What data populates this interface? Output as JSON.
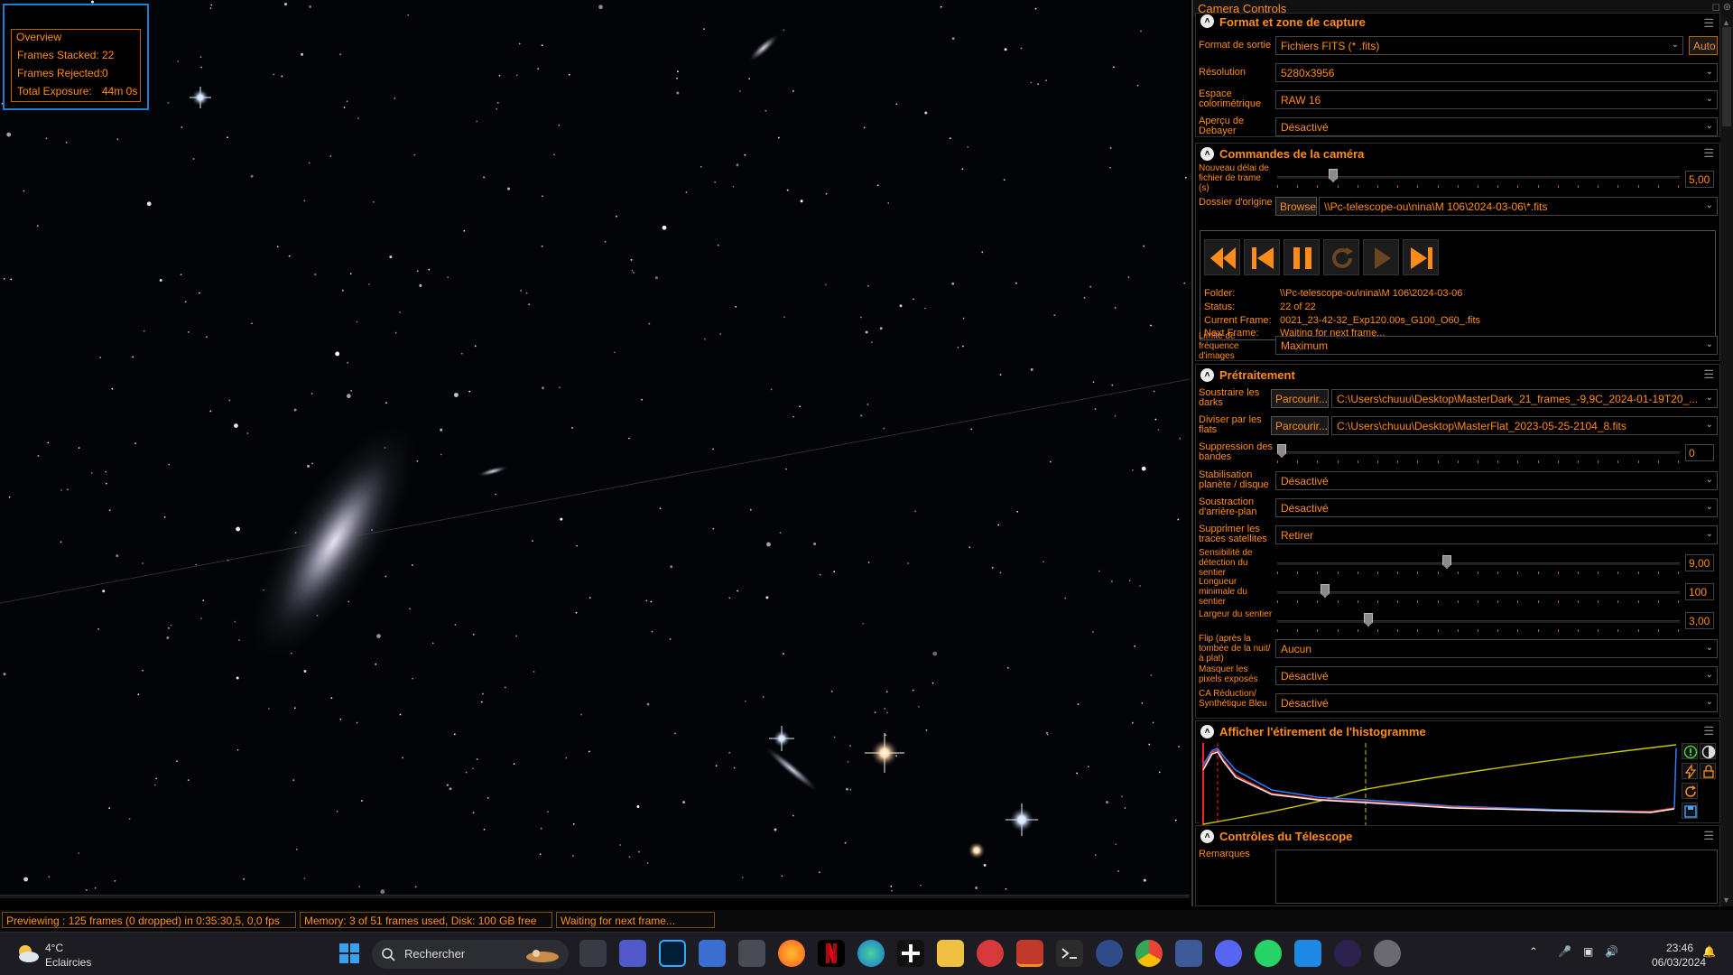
{
  "overview": {
    "title": "Overview",
    "stats": [
      {
        "label": "Frames Stacked:",
        "value": "22"
      },
      {
        "label": "Frames Rejected:",
        "value": "0"
      },
      {
        "label": "Total Exposure:",
        "value": "44m 0s"
      }
    ]
  },
  "statusbar": {
    "preview": "Previewing : 125 frames (0 dropped) in 0:35:30,5, 0,0 fps",
    "memory": "Memory: 3 of 51 frames used, Disk: 100 GB free",
    "status": "Waiting for next frame..."
  },
  "panel": {
    "title": "Camera Controls",
    "format": {
      "title": "Format et zone de capture",
      "output_label": "Format de sortie",
      "output_value": "Fichiers FITS (* .fits)",
      "auto_label": "Auto",
      "resolution_label": "Résolution",
      "resolution_value": "5280x3956",
      "colorspace_label": "Espace colorimétrique",
      "colorspace_value": "RAW 16",
      "debayer_label": "Aperçu de Debayer",
      "debayer_value": "Désactivé"
    },
    "camera": {
      "title": "Commandes de la caméra",
      "delay_label": "Nouveau délai de fichier de trame (s)",
      "delay_value": "5,00",
      "delay_level": 0.13,
      "folder_label": "Dossier d'origine",
      "browse_label": "Browse",
      "folder_value": "\\\\Pc-telescope-ou\\nina\\M 106\\2024-03-06\\*.fits",
      "info": {
        "folder_label": "Folder:",
        "folder_value": "\\\\Pc-telescope-ou\\nina\\M 106\\2024-03-06",
        "status_label": "Status:",
        "status_value": "22 of 22",
        "current_label": "Current Frame:",
        "current_value": "0021_23-42-32_Exp120.00s_G100_O60_.fits",
        "next_label": "Next Frame:",
        "next_value": "Waiting for next frame..."
      },
      "rate_label": "Limite de fréquence d'images",
      "rate_value": "Maximum"
    },
    "preprocess": {
      "title": "Prétraitement",
      "darks_label": "Soustraire les darks",
      "darks_button": "Parcourir...",
      "darks_value": "C:\\Users\\chuuu\\Desktop\\MasterDark_21_frames_-9,9C_2024-01-19T20_...",
      "flats_label": "Diviser par les flats",
      "flats_button": "Parcourir...",
      "flats_value": "C:\\Users\\chuuu\\Desktop\\MasterFlat_2023-05-25-2104_8.fits",
      "banding_label": "Suppression des bandes",
      "banding_value": "0",
      "banding_level": 0,
      "stab_label": "Stabilisation planète / disque",
      "stab_value": "Désactivé",
      "bg_label": "Soustraction d'arrière-plan",
      "bg_value": "Désactivé",
      "sat_label": "Supprimer les traces satellites",
      "sat_value": "Retirer",
      "sens_label": "Sensibilité de détection du sentier",
      "sens_value": "9,00",
      "sens_level": 0.42,
      "minlen_label": "Longueur minimale du sentier",
      "minlen_value": "100",
      "minlen_level": 0.11,
      "width_label": "Largeur du sentier",
      "width_value": "3,00",
      "width_level": 0.22,
      "flip_label": "Flip (après la tombée de la nuit/à plat)",
      "flip_value": "Aucun",
      "hot_label": "Masquer les pixels exposés",
      "hot_value": "Désactivé",
      "ca_label": "CA Réduction/ Synthétique Bleu",
      "ca_value": "Désactivé"
    },
    "histogram": {
      "title": "Afficher l'étirement de l'histogramme"
    },
    "telescope": {
      "title": "Contrôles du Télescope",
      "notes_label": "Remarques"
    }
  },
  "taskbar": {
    "weather_temp": "4°C",
    "weather_desc": "Eclaircies",
    "search_placeholder": "Rechercher",
    "time": "23:46",
    "date": "06/03/2024"
  },
  "colors": {
    "accent": "#ff8c1a",
    "border_blue": "#1e7fd8"
  }
}
